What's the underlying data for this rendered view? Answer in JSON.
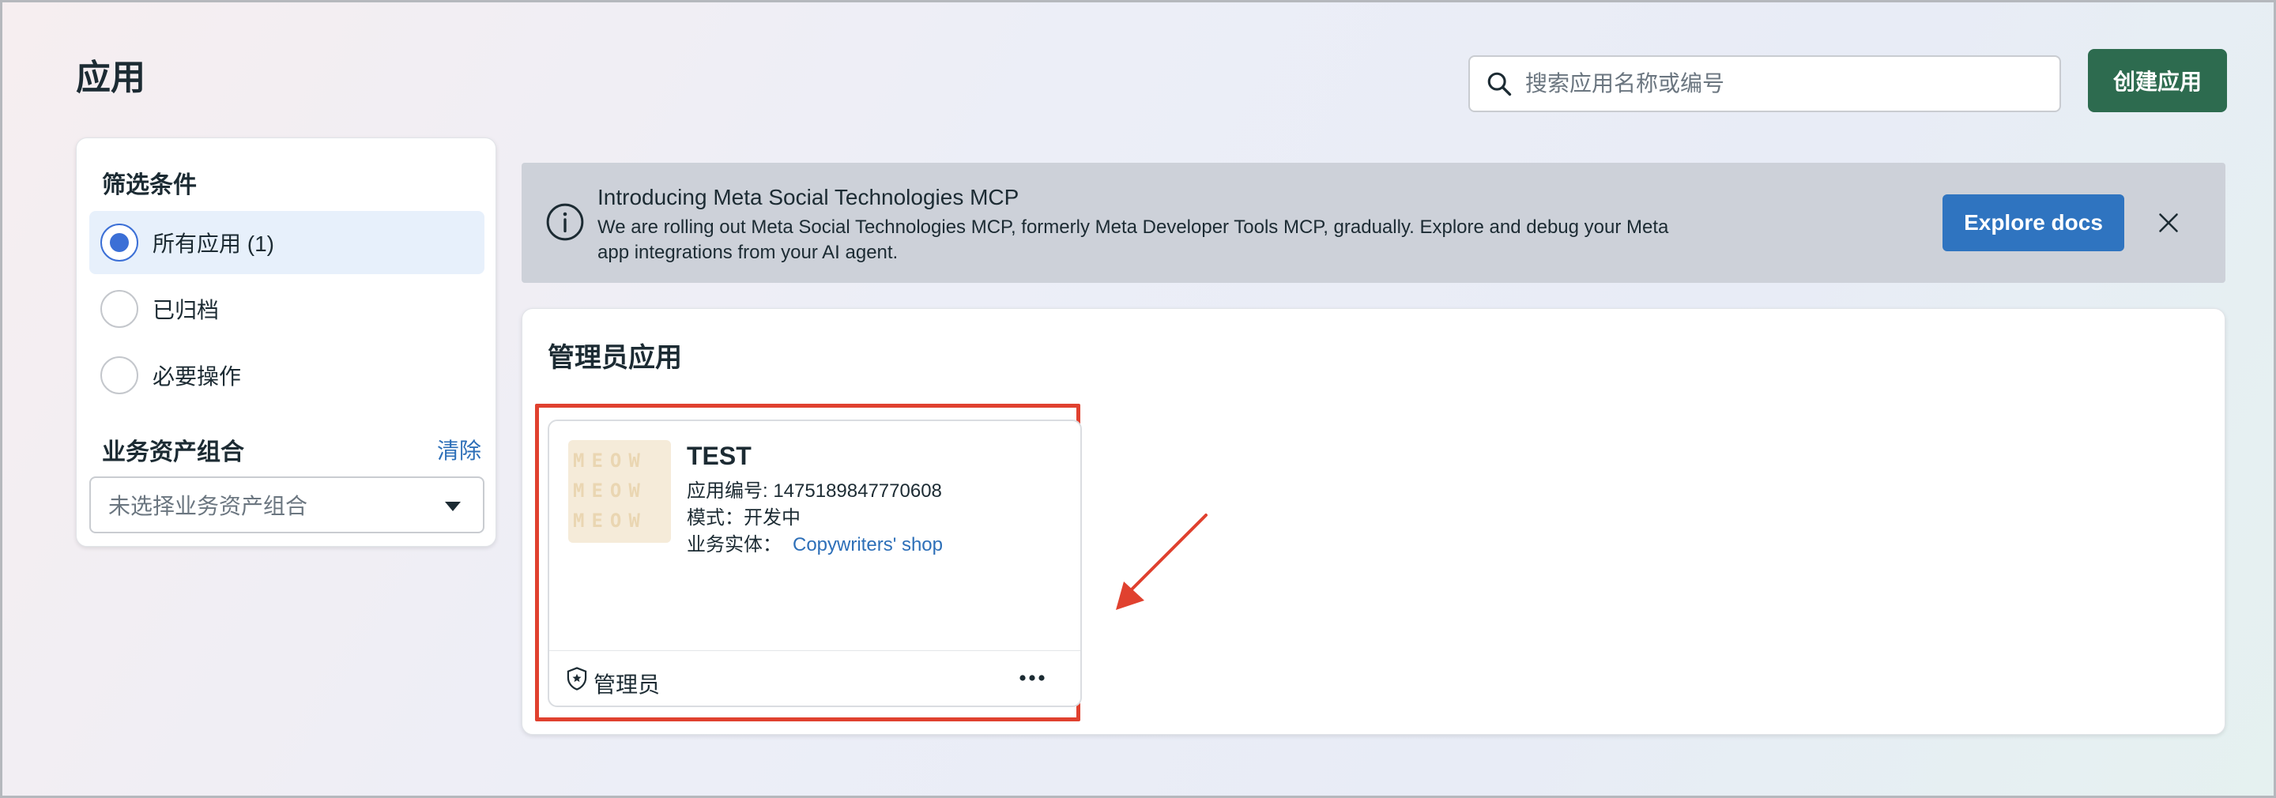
{
  "page": {
    "title": "应用"
  },
  "search": {
    "placeholder": "搜索应用名称或编号"
  },
  "header": {
    "create_button": "创建应用"
  },
  "filters": {
    "title": "筛选条件",
    "options": [
      {
        "label": "所有应用 (1)",
        "selected": true
      },
      {
        "label": "已归档",
        "selected": false
      },
      {
        "label": "必要操作",
        "selected": false
      }
    ],
    "asset_group_title": "业务资产组合",
    "clear_label": "清除",
    "asset_select_placeholder": "未选择业务资产组合"
  },
  "banner": {
    "title": "Introducing Meta Social Technologies MCP",
    "text": "We are rolling out Meta Social Technologies MCP, formerly Meta Developer Tools MCP, gradually. Explore and debug your Meta app integrations from your AI agent.",
    "button": "Explore docs",
    "icon": "info-icon"
  },
  "apps": {
    "section_title": "管理员应用",
    "cards": [
      {
        "name": "TEST",
        "app_id_line": "应用编号: 1475189847770608",
        "mode_line": "模式：开发中",
        "business_label": "业务实体：",
        "business_link": "Copywriters' shop",
        "role": "管理员",
        "thumbnail_text": [
          "MEOW",
          "MEOW",
          "MEOW"
        ]
      }
    ]
  },
  "colors": {
    "primary_green": "#2d6b4f",
    "primary_blue": "#2f74c0",
    "highlight_red": "#e0412f",
    "link_blue": "#2d6fb8"
  }
}
